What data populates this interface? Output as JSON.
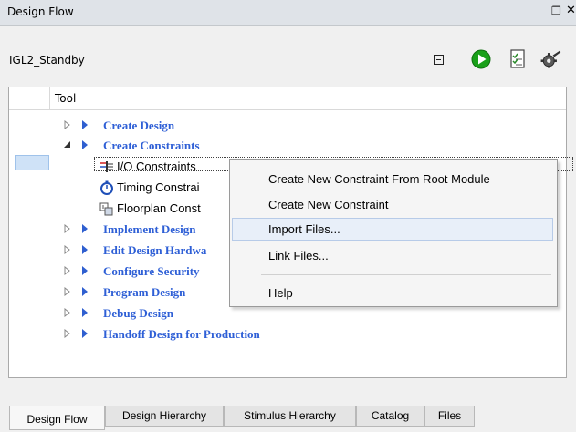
{
  "window": {
    "title": "Design Flow"
  },
  "project": {
    "name": "IGL2_Standby"
  },
  "tree": {
    "header": "Tool",
    "rows": [
      {
        "label": "Create Design",
        "expanded": false
      },
      {
        "label": "Create Constraints",
        "expanded": true
      },
      {
        "label": "I/O Constraints"
      },
      {
        "label": "Timing Constrai"
      },
      {
        "label": "Floorplan Const"
      },
      {
        "label": "Implement Design",
        "expanded": false
      },
      {
        "label": "Edit Design Hardwa",
        "expanded": false
      },
      {
        "label": "Configure Security",
        "expanded": false
      },
      {
        "label": "Program Design",
        "expanded": false
      },
      {
        "label": "Debug Design",
        "expanded": false
      },
      {
        "label": "Handoff Design for Production",
        "expanded": false
      }
    ]
  },
  "context_menu": {
    "items": [
      {
        "label": "Create New Constraint From Root Module"
      },
      {
        "label": "Create New Constraint"
      },
      {
        "label": "Import Files...",
        "highlighted": true
      },
      {
        "label": "Link Files..."
      },
      {
        "label": "Help"
      }
    ]
  },
  "tabs": [
    {
      "label": "Design Flow",
      "active": true
    },
    {
      "label": "Design Hierarchy"
    },
    {
      "label": "Stimulus Hierarchy"
    },
    {
      "label": "Catalog"
    },
    {
      "label": "Files"
    }
  ],
  "colors": {
    "link_blue": "#2e5fd6",
    "run_green": "#19a019",
    "selection": "#cfe2f7"
  },
  "icons": [
    "collapse-all-icon",
    "run-icon",
    "report-icon",
    "configure-gear-icon",
    "float-icon",
    "close-icon",
    "expand-arrow-icon",
    "collapse-arrow-icon",
    "io-constraints-icon",
    "timing-stopwatch-icon",
    "floorplan-icon"
  ]
}
